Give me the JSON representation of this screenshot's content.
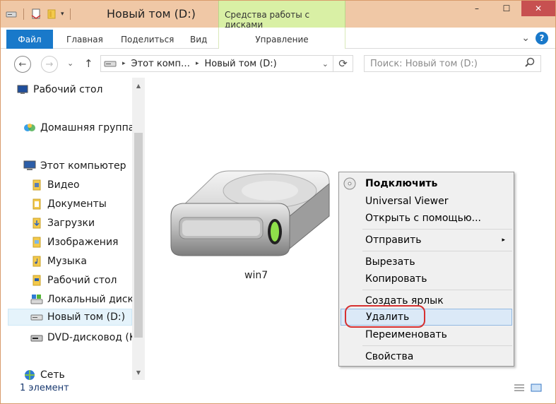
{
  "window": {
    "title": "Новый том (D:)"
  },
  "titlebar": {
    "context_group_label": "Средства работы с дисками",
    "minimize": "–",
    "maximize": "☐",
    "close": "✕"
  },
  "ribbon": {
    "tabs": {
      "file": "Файл",
      "home": "Главная",
      "share": "Поделиться",
      "view": "Вид",
      "manage": "Управление"
    },
    "expand": "⌄",
    "help": "?"
  },
  "address": {
    "crumbs": [
      "Этот комп…",
      "Новый том (D:)"
    ],
    "separator": "▸",
    "dropdown": "⌄",
    "refresh": "⟳",
    "search_placeholder": "Поиск: Новый том (D:)"
  },
  "navigation": {
    "back": "←",
    "forward": "→",
    "recent": "⌄",
    "up": "↑",
    "items": [
      {
        "label": "Рабочий стол",
        "icon": "desktop-icon"
      },
      {
        "label": "Домашняя группа",
        "icon": "homegroup-icon"
      },
      {
        "label": "Этот компьютер",
        "icon": "computer-icon"
      },
      {
        "label": "Видео",
        "icon": "video-folder-icon"
      },
      {
        "label": "Документы",
        "icon": "documents-folder-icon"
      },
      {
        "label": "Загрузки",
        "icon": "downloads-folder-icon"
      },
      {
        "label": "Изображения",
        "icon": "pictures-folder-icon"
      },
      {
        "label": "Музыка",
        "icon": "music-folder-icon"
      },
      {
        "label": "Рабочий стол",
        "icon": "desktop-folder-icon"
      },
      {
        "label": "Локальный диск",
        "icon": "local-disk-icon"
      },
      {
        "label": "Новый том (D:)",
        "icon": "drive-icon"
      },
      {
        "label": "DVD-дисковод (K",
        "icon": "dvd-drive-icon"
      },
      {
        "label": "Сеть",
        "icon": "network-icon"
      }
    ]
  },
  "content": {
    "item_label": "win7"
  },
  "context_menu": {
    "items": [
      "Подключить",
      "Universal Viewer",
      "Открыть с помощью...",
      "Отправить",
      "Вырезать",
      "Копировать",
      "Создать ярлык",
      "Удалить",
      "Переименовать",
      "Свойства"
    ],
    "highlighted": "Удалить",
    "submenu_arrow": "▸"
  },
  "status": {
    "text": "1 элемент"
  },
  "colors": {
    "accent": "#1979ca",
    "titlebar": "#f0c8a6",
    "context_tab": "#d9f0a5",
    "annotation": "#d63030"
  }
}
